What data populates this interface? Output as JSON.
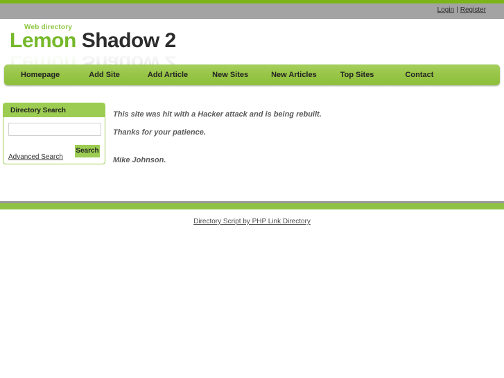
{
  "utility_bar": {
    "login_label": "Login",
    "separator": "|",
    "register_label": "Register"
  },
  "logo": {
    "kicker": "Web directory",
    "name_part1": "Lemon",
    "name_part2": "Shadow 2",
    "green_hex": "#76b82a",
    "dark_hex": "#2d2d2d"
  },
  "nav": {
    "items": [
      {
        "label": "Homepage"
      },
      {
        "label": "Add Site"
      },
      {
        "label": "Add Article"
      },
      {
        "label": "New Sites"
      },
      {
        "label": "New Articles"
      },
      {
        "label": "Top Sites"
      },
      {
        "label": "Contact"
      }
    ]
  },
  "sidebar": {
    "title": "Directory Search",
    "search_value": "",
    "search_placeholder": "",
    "advanced_search_label": "Advanced Search",
    "search_button_label": "Search"
  },
  "content": {
    "line1": "This site was hit with a Hacker attack and is being rebuilt.",
    "line2": "Thanks for your patience.",
    "signature": "Mike Johnson."
  },
  "footer": {
    "link_label": "Directory Script by PHP Link Directory",
    "bar_hex": "#8fc144"
  },
  "theme": {
    "accent_green": "#9ccc52",
    "dark_green": "#7cb518",
    "gray_bar": "#a3a3a3"
  }
}
